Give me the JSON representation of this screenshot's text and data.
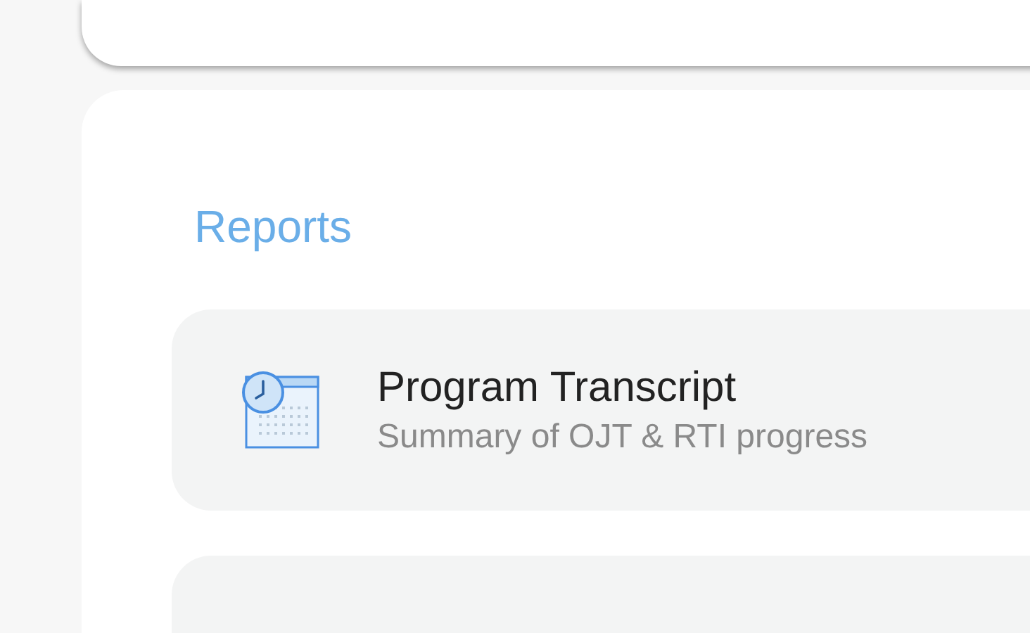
{
  "section": {
    "title": "Reports"
  },
  "reports": [
    {
      "title": "Program Transcript",
      "subtitle": "Summary of OJT & RTI progress"
    }
  ]
}
